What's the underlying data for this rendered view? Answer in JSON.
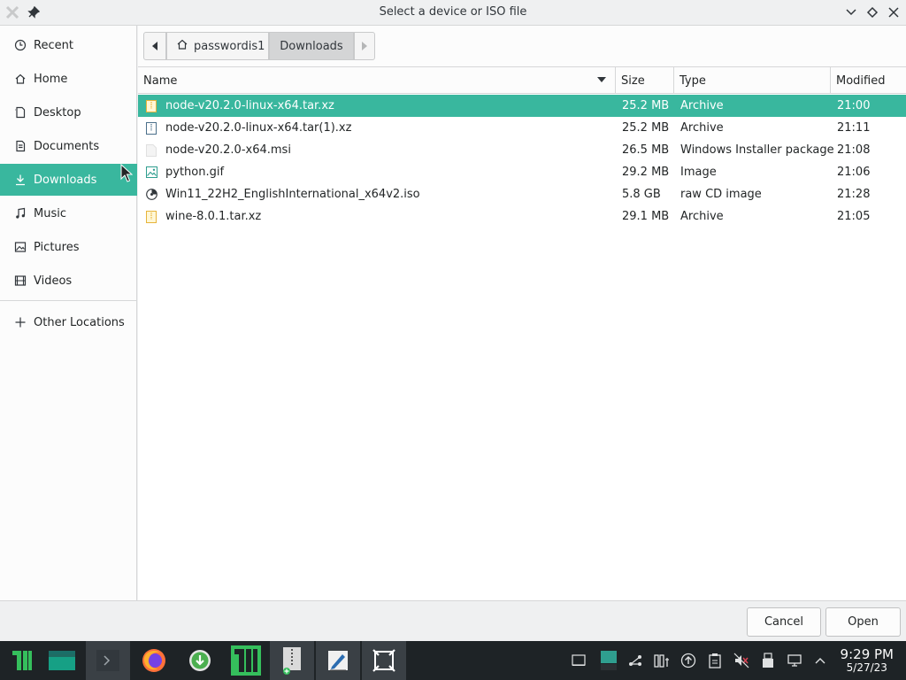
{
  "window": {
    "title": "Select a device or ISO file"
  },
  "sidebar": {
    "items": [
      {
        "label": "Recent",
        "icon": "clock-icon"
      },
      {
        "label": "Home",
        "icon": "home-icon"
      },
      {
        "label": "Desktop",
        "icon": "desktop-icon"
      },
      {
        "label": "Documents",
        "icon": "documents-icon"
      },
      {
        "label": "Downloads",
        "icon": "download-icon",
        "active": true
      },
      {
        "label": "Music",
        "icon": "music-icon"
      },
      {
        "label": "Pictures",
        "icon": "pictures-icon"
      },
      {
        "label": "Videos",
        "icon": "videos-icon"
      }
    ],
    "other_locations": "Other Locations"
  },
  "pathbar": {
    "home_label": "passwordis1",
    "current_label": "Downloads"
  },
  "columns": {
    "name": "Name",
    "size": "Size",
    "type": "Type",
    "modified": "Modified"
  },
  "files": [
    {
      "name": "node-v20.2.0-linux-x64.tar.xz",
      "size": "25.2 MB",
      "type": "Archive",
      "modified": "21:00",
      "icon": "archive-icon",
      "selected": true
    },
    {
      "name": "node-v20.2.0-linux-x64.tar(1).xz",
      "size": "25.2 MB",
      "type": "Archive",
      "modified": "21:11",
      "icon": "archive-icon"
    },
    {
      "name": "node-v20.2.0-x64.msi",
      "size": "26.5 MB",
      "type": "Windows Installer package",
      "modified": "21:08",
      "icon": "file-icon"
    },
    {
      "name": "python.gif",
      "size": "29.2 MB",
      "type": "Image",
      "modified": "21:06",
      "icon": "image-icon"
    },
    {
      "name": "Win11_22H2_EnglishInternational_x64v2.iso",
      "size": "5.8 GB",
      "type": "raw CD image",
      "modified": "21:28",
      "icon": "disc-icon"
    },
    {
      "name": "wine-8.0.1.tar.xz",
      "size": "29.1 MB",
      "type": "Archive",
      "modified": "21:05",
      "icon": "archive-icon"
    }
  ],
  "actions": {
    "cancel": "Cancel",
    "open": "Open"
  },
  "taskbar": {
    "time": "9:29 PM",
    "date": "5/27/23"
  },
  "colors": {
    "accent": "#39b79e",
    "taskbar": "#1e2326"
  }
}
